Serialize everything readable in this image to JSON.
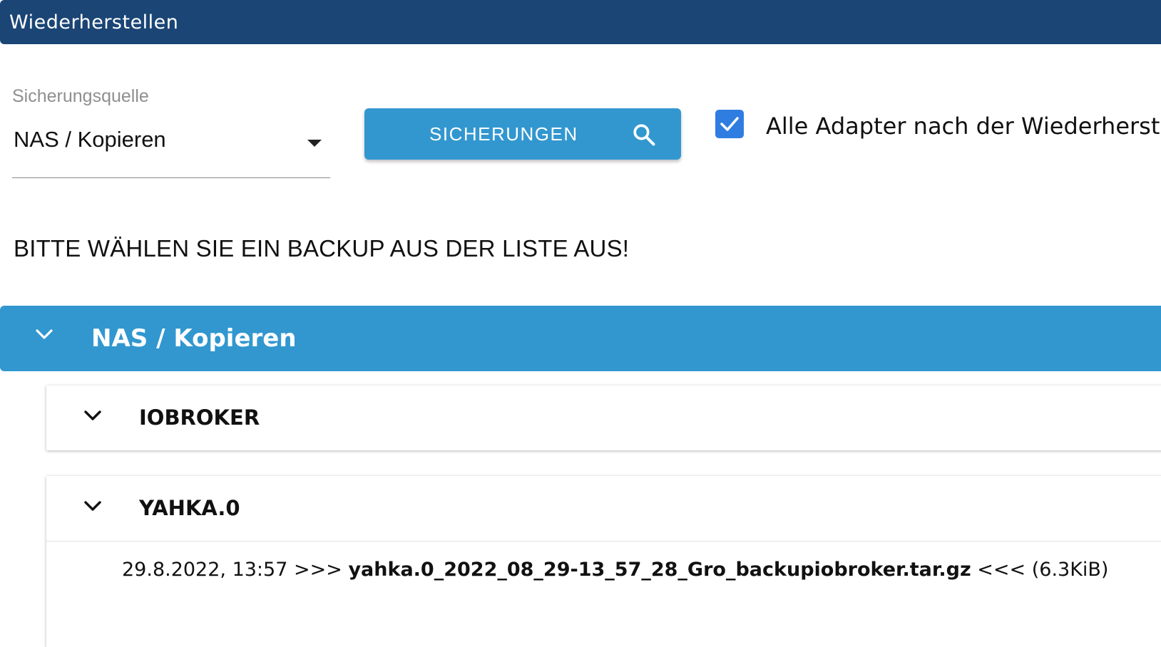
{
  "window": {
    "title": "Wiederherstellen"
  },
  "source": {
    "label": "Sicherungsquelle",
    "value": "NAS / Kopieren"
  },
  "search_button": {
    "label": "SICHERUNGEN",
    "icon": "search-icon"
  },
  "restart_adapters": {
    "checked": true,
    "label": "Alle Adapter nach der Wiederherstel"
  },
  "instruction": "BITTE WÄHLEN SIE EIN BACKUP AUS DER LISTE AUS!",
  "tree": {
    "root_label": "NAS / Kopieren",
    "groups": [
      {
        "label": "IOBROKER",
        "entries": []
      },
      {
        "label": "YAHKA.0",
        "entries": [
          {
            "date": "29.8.2022, 13:57",
            "prefix": ">>>",
            "filename": "yahka.0_2022_08_29-13_57_28_Gro_backupiobroker.tar.gz",
            "suffix": "<<<",
            "size": "(6.3KiB)"
          }
        ]
      }
    ]
  },
  "colors": {
    "titlebar": "#1a4575",
    "accent": "#3297cf",
    "checkbox": "#2f7de1"
  }
}
